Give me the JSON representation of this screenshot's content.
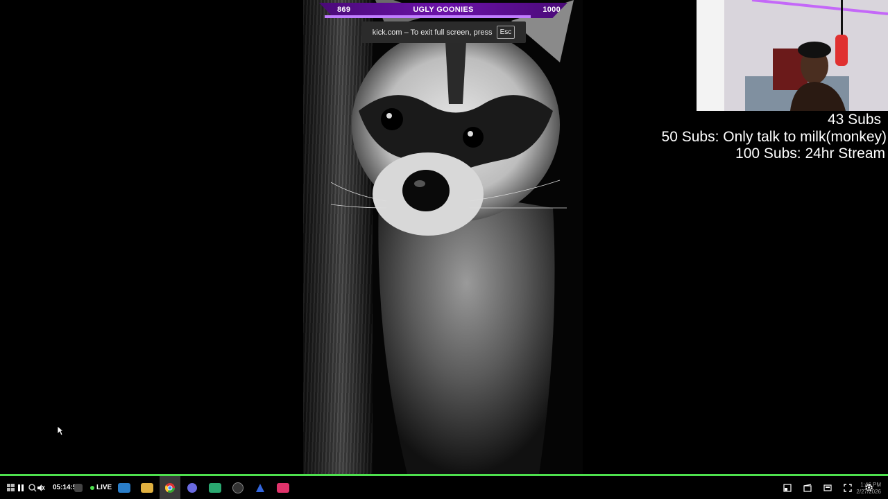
{
  "goal_bar": {
    "current": "869",
    "title": "UGLY GOONIES",
    "target": "1000",
    "progress": 0.869
  },
  "fullscreen_notice": {
    "message": "kick.com – To exit full screen, press",
    "key": "Esc"
  },
  "sub_goals": {
    "current": "43 Subs",
    "goal_1": "50 Subs: Only talk to milk(monkey)",
    "goal_2": "100 Subs: 24hr Stream"
  },
  "taskbar": {
    "stream_time": "05:14:54",
    "live_label": "LIVE",
    "clock_time": "1:46 PM",
    "clock_date": "2/27/2026"
  },
  "colors": {
    "accent_purple": "#6b12a8",
    "live_green": "#4ee04e"
  },
  "icons": [
    "windows-start-icon",
    "pause-icon",
    "search-icon",
    "mute-icon",
    "folder-icon",
    "chrome-icon",
    "discord-icon",
    "obs-icon",
    "music-icon",
    "picture-in-picture-icon",
    "theater-mode-icon",
    "miniplayer-icon",
    "fullscreen-icon",
    "settings-icon"
  ]
}
